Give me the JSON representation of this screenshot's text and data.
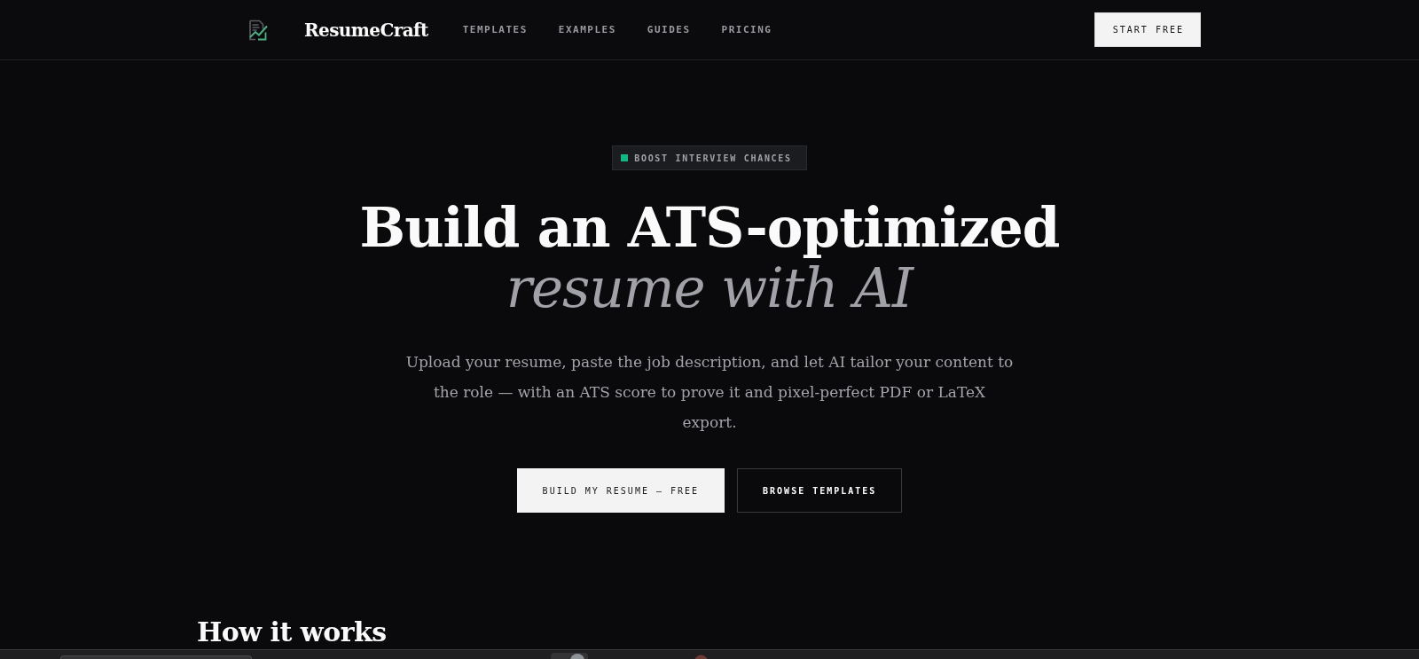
{
  "header": {
    "brand": "ResumeCraft",
    "nav": [
      {
        "label": "TEMPLATES"
      },
      {
        "label": "EXAMPLES"
      },
      {
        "label": "GUIDES"
      },
      {
        "label": "PRICING"
      }
    ],
    "cta": "START FREE"
  },
  "hero": {
    "badge": "BOOST INTERVIEW CHANCES",
    "title": "Build an ATS-optimized",
    "title_accent": "resume with AI",
    "description": "Upload your resume, paste the job description, and let AI tailor your content to the role — with an ATS score to prove it and pixel-perfect PDF or LaTeX export.",
    "buttons": [
      {
        "label": "BUILD MY RESUME — FREE",
        "kind": "primary"
      },
      {
        "label": "BROWSE TEMPLATES",
        "kind": "secondary"
      }
    ]
  },
  "next_section": {
    "heading": "How it works"
  }
}
